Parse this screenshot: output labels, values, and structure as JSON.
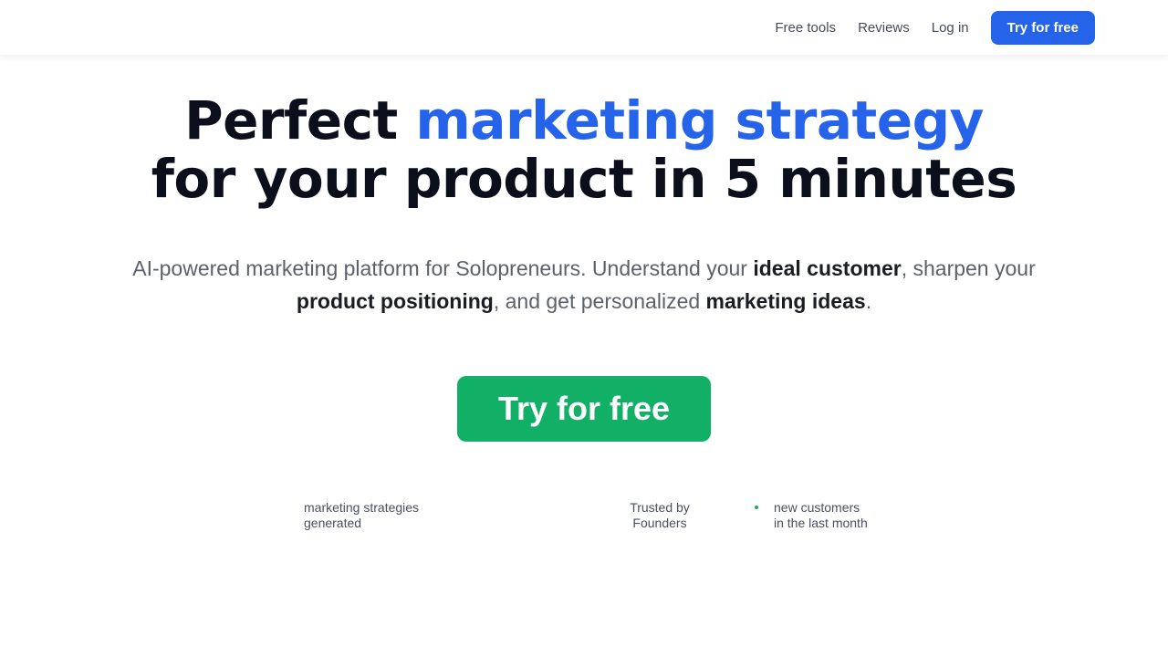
{
  "nav": {
    "links": [
      "Free tools",
      "Reviews",
      "Log in"
    ],
    "cta_label": "Try for free"
  },
  "hero": {
    "title_part1": "Perfect ",
    "title_accent": "marketing strategy",
    "title_line2": "for your product in 5 minutes",
    "subtitle": {
      "t1": "AI-powered marketing platform for Solopreneurs. Understand your ",
      "b1": "ideal customer",
      "t2": ", sharpen your ",
      "b2": "product positioning",
      "t3": ", and get personalized ",
      "b3": "marketing ideas",
      "t4": "."
    },
    "cta_label": "Try for free"
  },
  "stats": {
    "strategies": {
      "line1": "marketing strategies",
      "line2": "generated"
    },
    "trusted": {
      "line1": "Trusted by",
      "line2": "Founders"
    },
    "customers": {
      "line1": "new customers",
      "line2": "in the last month"
    }
  },
  "colors": {
    "accent": "#2563eb",
    "cta_green": "#12b066",
    "heading": "#0b0f1c"
  }
}
